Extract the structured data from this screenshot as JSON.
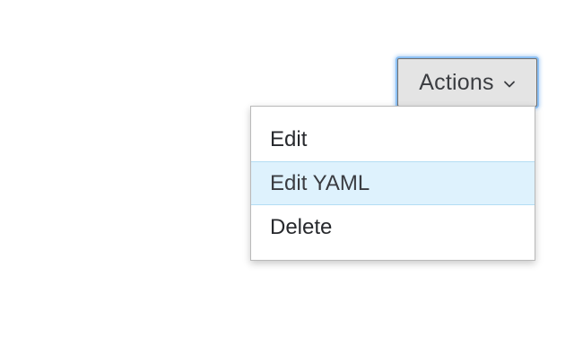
{
  "actions_button": {
    "label": "Actions",
    "icon": "chevron-down-icon"
  },
  "menu": {
    "items": [
      {
        "label": "Edit"
      },
      {
        "label": "Edit YAML",
        "hovered": true
      },
      {
        "label": "Delete"
      }
    ]
  },
  "colors": {
    "button_bg": "#e4e4e4",
    "focus_ring": "#8cc0f4",
    "hover_bg": "#def2fd",
    "hover_border": "#b3ddf4",
    "text": "#27292d"
  }
}
